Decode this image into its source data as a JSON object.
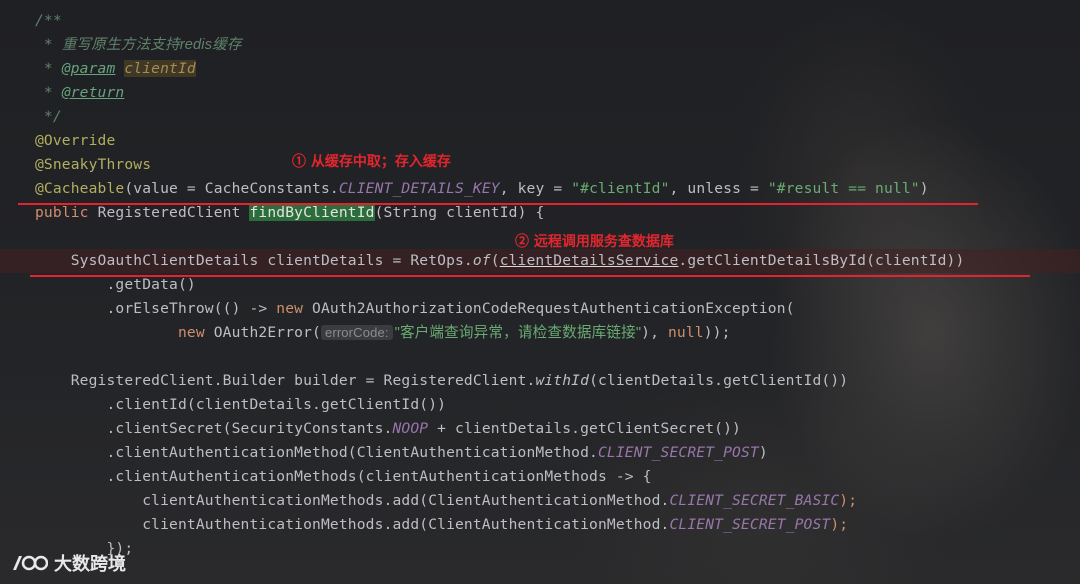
{
  "editor": {
    "lines": [
      [
        {
          "t": "/**",
          "c": "c-comment"
        }
      ],
      [
        {
          "t": " * ",
          "c": "c-comment"
        },
        {
          "t": "重写原生方法支持redis缓存",
          "c": "c-comment c-cn"
        }
      ],
      [
        {
          "t": " * ",
          "c": "c-comment"
        },
        {
          "t": "@param",
          "c": "c-tag"
        },
        {
          "t": " ",
          "c": "c-comment"
        },
        {
          "t": "clientId",
          "c": "c-param"
        }
      ],
      [
        {
          "t": " * ",
          "c": "c-comment"
        },
        {
          "t": "@return",
          "c": "c-tag"
        }
      ],
      [
        {
          "t": " */",
          "c": "c-comment"
        }
      ],
      [
        {
          "t": "@Override",
          "c": "c-ann"
        }
      ],
      [
        {
          "t": "@SneakyThrows",
          "c": "c-ann"
        }
      ],
      [
        {
          "t": "@Cacheable",
          "c": "c-ann"
        },
        {
          "t": "(value = CacheConstants.",
          "c": ""
        },
        {
          "t": "CLIENT_DETAILS_KEY",
          "c": "c-const"
        },
        {
          "t": ", key = ",
          "c": ""
        },
        {
          "t": "\"#clientId\"",
          "c": "c-str"
        },
        {
          "t": ", unless = ",
          "c": ""
        },
        {
          "t": "\"#result == null\"",
          "c": "c-str"
        },
        {
          "t": ")",
          "c": ""
        }
      ],
      [
        {
          "t": "public ",
          "c": "c-kw"
        },
        {
          "t": "RegisteredClient ",
          "c": ""
        },
        {
          "t": "findByClientId",
          "c": "c-fn"
        },
        {
          "t": "(String clientId) {",
          "c": ""
        }
      ],
      [],
      [
        {
          "t": "    SysOauthClientDetails clientDetails = RetOps.",
          "c": ""
        },
        {
          "t": "of",
          "c": "c-static"
        },
        {
          "t": "(",
          "c": ""
        },
        {
          "t": "clientDetailsService",
          "c": "c-underline"
        },
        {
          "t": ".getClientDetailsById(clientId))",
          "c": ""
        }
      ],
      [
        {
          "t": "        .getData()",
          "c": ""
        }
      ],
      [
        {
          "t": "        .orElseThrow(() -> ",
          "c": ""
        },
        {
          "t": "new ",
          "c": "c-kw"
        },
        {
          "t": "OAuth2AuthorizationCodeRequestAuthenticationException(",
          "c": ""
        }
      ],
      [
        {
          "t": "                ",
          "c": ""
        },
        {
          "t": "new ",
          "c": "c-kw"
        },
        {
          "t": "OAuth2Error(",
          "c": ""
        },
        {
          "t": "errorCode:",
          "c": "c-hint"
        },
        {
          "t": "\"客户端查询异常，请检查数据库链接\"",
          "c": "c-str c-cn"
        },
        {
          "t": "), ",
          "c": ""
        },
        {
          "t": "null",
          "c": "c-kw"
        },
        {
          "t": "));",
          "c": ""
        }
      ],
      [],
      [
        {
          "t": "    RegisteredClient.Builder builder = RegisteredClient.",
          "c": ""
        },
        {
          "t": "withId",
          "c": "c-static"
        },
        {
          "t": "(clientDetails.getClientId())",
          "c": ""
        }
      ],
      [
        {
          "t": "        .clientId(clientDetails.getClientId())",
          "c": ""
        }
      ],
      [
        {
          "t": "        .clientSecret(SecurityConstants.",
          "c": ""
        },
        {
          "t": "NOOP",
          "c": "c-const"
        },
        {
          "t": " + clientDetails.getClientSecret())",
          "c": ""
        }
      ],
      [
        {
          "t": "        .clientAuthenticationMethod(ClientAuthenticationMethod.",
          "c": ""
        },
        {
          "t": "CLIENT_SECRET_POST",
          "c": "c-const"
        },
        {
          "t": ")",
          "c": ""
        }
      ],
      [
        {
          "t": "        .clientAuthenticationMethods(clientAuthenticationMethods -> {",
          "c": ""
        }
      ],
      [
        {
          "t": "            clientAuthenticationMethods.add(ClientAuthenticationMethod.",
          "c": ""
        },
        {
          "t": "CLIENT_SECRET_BASIC",
          "c": "c-const"
        },
        {
          "t": ");",
          "c": "c-kw"
        }
      ],
      [
        {
          "t": "            clientAuthenticationMethods.add(ClientAuthenticationMethod.",
          "c": ""
        },
        {
          "t": "CLIENT_SECRET_POST",
          "c": "c-const"
        },
        {
          "t": ");",
          "c": "c-kw"
        }
      ],
      [
        {
          "t": "        });",
          "c": ""
        }
      ]
    ],
    "highlighted_line": 10
  },
  "annotations": {
    "note1": "① 从缓存中取；存入缓存",
    "note2": "② 远程调用服务查数据库"
  },
  "watermark": {
    "icon": "logo-icon",
    "text": "大数跨境"
  },
  "colors": {
    "annotation_red": "#e8222d",
    "keyword": "#cf8e6d",
    "string": "#6aab73",
    "annotation": "#b3ae60",
    "comment": "#5f826b",
    "constant": "#9876aa"
  }
}
